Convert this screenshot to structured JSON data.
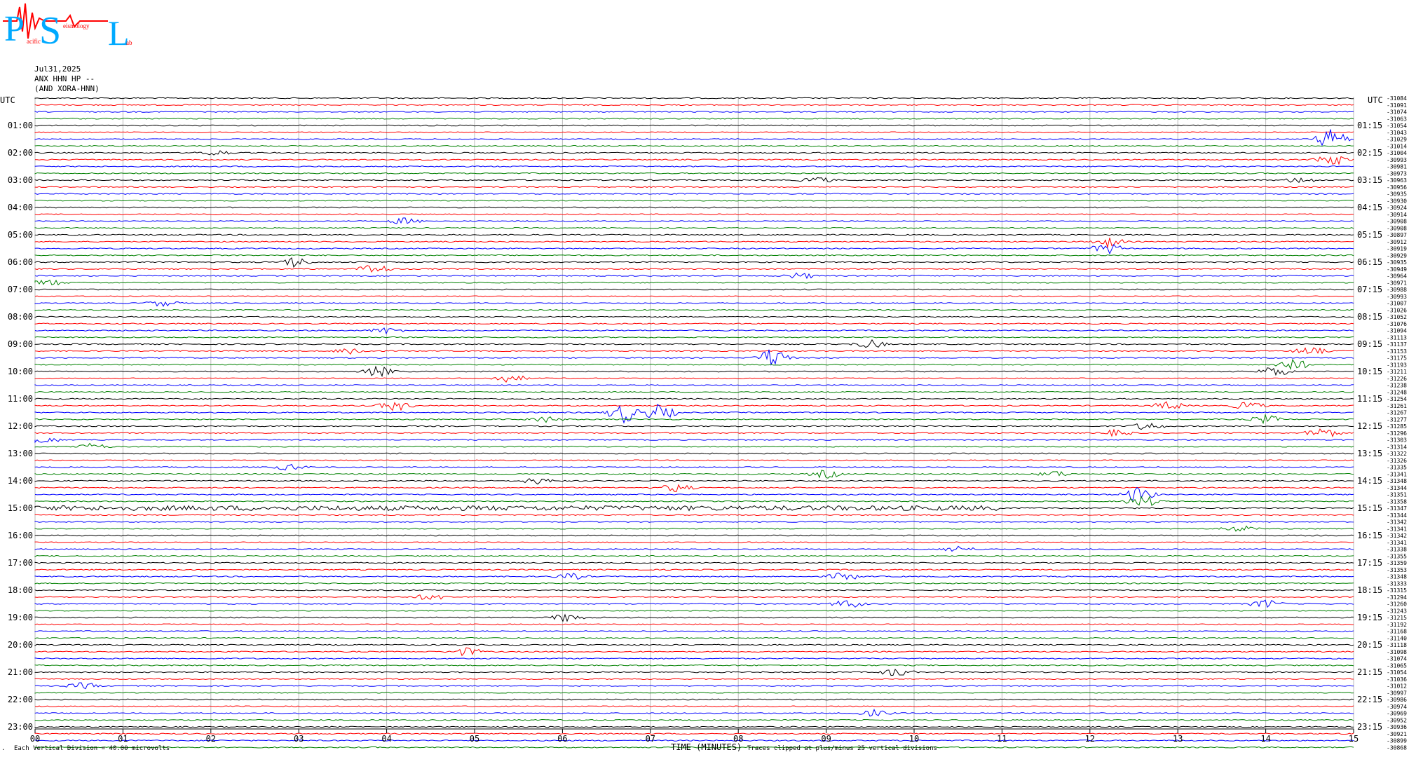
{
  "logo": {
    "letters": [
      "P",
      "S",
      "L"
    ],
    "subtext": [
      "acific",
      "eismology",
      "ab"
    ]
  },
  "header": {
    "date": "Jul31,2025",
    "channel": "ANX HHN HP --",
    "network": "(AND XORA-HNN)"
  },
  "chart_data": {
    "type": "line",
    "title": "ANX HHN HP --",
    "xlabel": "TIME (MINUTES)",
    "x_ticks": [
      "00",
      "01",
      "02",
      "03",
      "04",
      "05",
      "06",
      "07",
      "08",
      "09",
      "10",
      "11",
      "12",
      "13",
      "14",
      "15"
    ],
    "xlim": [
      0,
      15
    ],
    "left_axis_label": "UTC",
    "right_axis_label": "UTC",
    "left_hour_labels": [
      "01:00",
      "02:00",
      "03:00",
      "04:00",
      "05:00",
      "06:00",
      "07:00",
      "08:00",
      "09:00",
      "10:00",
      "11:00",
      "12:00",
      "13:00",
      "14:00",
      "15:00",
      "16:00",
      "17:00",
      "18:00",
      "19:00",
      "20:00",
      "21:00",
      "22:00",
      "23:00"
    ],
    "right_hour_labels": [
      "01:15",
      "02:15",
      "03:15",
      "04:15",
      "05:15",
      "06:15",
      "07:15",
      "08:15",
      "09:15",
      "10:15",
      "11:15",
      "12:15",
      "13:15",
      "14:15",
      "15:15",
      "16:15",
      "17:15",
      "18:15",
      "19:15",
      "20:15",
      "21:15",
      "22:15",
      "23:15"
    ],
    "trace_colors": [
      "#000000",
      "#ff0000",
      "#0000ff",
      "#008000"
    ],
    "trace_count": 96,
    "right_offsets": [
      "-31084",
      "-31091",
      "-31074",
      "-31063",
      "-31054",
      "-31043",
      "-31029",
      "-31014",
      "-31004",
      "-30993",
      "-30981",
      "-30973",
      "-30963",
      "-30956",
      "-30935",
      "-30930",
      "-30924",
      "-30914",
      "-30908",
      "-30908",
      "-30897",
      "-30912",
      "-30919",
      "-30929",
      "-30935",
      "-30949",
      "-30964",
      "-30971",
      "-30988",
      "-30993",
      "-31007",
      "-31026",
      "-31052",
      "-31076",
      "-31094",
      "-31113",
      "-31137",
      "-31153",
      "-31175",
      "-31193",
      "-31211",
      "-31226",
      "-31238",
      "-31248",
      "-31254",
      "-31261",
      "-31267",
      "-31277",
      "-31285",
      "-31296",
      "-31303",
      "-31314",
      "-31322",
      "-31326",
      "-31335",
      "-31341",
      "-31348",
      "-31344",
      "-31351",
      "-31358",
      "-31347",
      "-31344",
      "-31342",
      "-31341",
      "-31342",
      "-31341",
      "-31338",
      "-31355",
      "-31359",
      "-31353",
      "-31348",
      "-31333",
      "-31315",
      "-31294",
      "-31260",
      "-31243",
      "-31215",
      "-31192",
      "-31168",
      "-31140",
      "-31118",
      "-31098",
      "-31074",
      "-31065",
      "-31054",
      "-31036",
      "-31012",
      "-30997",
      "-30986",
      "-30974",
      "-30969",
      "-30952",
      "-30936",
      "-30921",
      "-30899",
      "-30868"
    ],
    "events": [
      {
        "trace": 6,
        "minute": 14.75,
        "amp": 5
      },
      {
        "trace": 8,
        "minute": 2.05,
        "amp": 1.5
      },
      {
        "trace": 9,
        "minute": 14.75,
        "amp": 3
      },
      {
        "trace": 12,
        "minute": 8.9,
        "amp": 1.5
      },
      {
        "trace": 12,
        "minute": 14.4,
        "amp": 1.5
      },
      {
        "trace": 18,
        "minute": 4.2,
        "amp": 1.5
      },
      {
        "trace": 21,
        "minute": 12.2,
        "amp": 2.5
      },
      {
        "trace": 22,
        "minute": 12.2,
        "amp": 2.5
      },
      {
        "trace": 24,
        "minute": 2.95,
        "amp": 2.5
      },
      {
        "trace": 25,
        "minute": 3.85,
        "amp": 2.5
      },
      {
        "trace": 26,
        "minute": 8.7,
        "amp": 1.5
      },
      {
        "trace": 27,
        "minute": 0.15,
        "amp": 1.5
      },
      {
        "trace": 30,
        "minute": 1.45,
        "amp": 1.5
      },
      {
        "trace": 34,
        "minute": 4.0,
        "amp": 1.5
      },
      {
        "trace": 36,
        "minute": 9.5,
        "amp": 2
      },
      {
        "trace": 37,
        "minute": 3.6,
        "amp": 2
      },
      {
        "trace": 37,
        "minute": 14.5,
        "amp": 2
      },
      {
        "trace": 38,
        "minute": 8.4,
        "amp": 5
      },
      {
        "trace": 39,
        "minute": 14.3,
        "amp": 3
      },
      {
        "trace": 40,
        "minute": 3.9,
        "amp": 2.5
      },
      {
        "trace": 40,
        "minute": 14.1,
        "amp": 2.5
      },
      {
        "trace": 41,
        "minute": 5.4,
        "amp": 2
      },
      {
        "trace": 45,
        "minute": 4.1,
        "amp": 2.5
      },
      {
        "trace": 45,
        "minute": 12.9,
        "amp": 2
      },
      {
        "trace": 45,
        "minute": 13.8,
        "amp": 2
      },
      {
        "trace": 46,
        "minute": 6.7,
        "amp": 5
      },
      {
        "trace": 46,
        "minute": 7.1,
        "amp": 4
      },
      {
        "trace": 47,
        "minute": 5.8,
        "amp": 1.5
      },
      {
        "trace": 47,
        "minute": 14.0,
        "amp": 2
      },
      {
        "trace": 48,
        "minute": 12.65,
        "amp": 2
      },
      {
        "trace": 49,
        "minute": 14.65,
        "amp": 3
      },
      {
        "trace": 49,
        "minute": 12.3,
        "amp": 1.5
      },
      {
        "trace": 50,
        "minute": 0.1,
        "amp": 1.5
      },
      {
        "trace": 51,
        "minute": 0.65,
        "amp": 1.5
      },
      {
        "trace": 54,
        "minute": 2.9,
        "amp": 1.5
      },
      {
        "trace": 55,
        "minute": 9.0,
        "amp": 2
      },
      {
        "trace": 55,
        "minute": 11.6,
        "amp": 1.5
      },
      {
        "trace": 56,
        "minute": 5.7,
        "amp": 1.5
      },
      {
        "trace": 57,
        "minute": 7.3,
        "amp": 2
      },
      {
        "trace": 58,
        "minute": 12.55,
        "amp": 3.5
      },
      {
        "trace": 59,
        "minute": 12.6,
        "amp": 3
      },
      {
        "trace": 63,
        "minute": 13.7,
        "amp": 1.5
      },
      {
        "trace": 66,
        "minute": 10.5,
        "amp": 1.5
      },
      {
        "trace": 70,
        "minute": 9.2,
        "amp": 2
      },
      {
        "trace": 70,
        "minute": 6.1,
        "amp": 1.5
      },
      {
        "trace": 73,
        "minute": 4.5,
        "amp": 1.5
      },
      {
        "trace": 74,
        "minute": 9.25,
        "amp": 2
      },
      {
        "trace": 74,
        "minute": 14.0,
        "amp": 2
      },
      {
        "trace": 76,
        "minute": 6.05,
        "amp": 2
      },
      {
        "trace": 81,
        "minute": 4.9,
        "amp": 2
      },
      {
        "trace": 84,
        "minute": 9.8,
        "amp": 2
      },
      {
        "trace": 86,
        "minute": 0.55,
        "amp": 1.5
      },
      {
        "trace": 90,
        "minute": 9.55,
        "amp": 1.5
      }
    ],
    "noisy_trace": 60
  },
  "footer": {
    "left": "Each Vertical Division =   40.00 microvolts",
    "xlabel": "TIME (MINUTES)",
    "note": "Traces clipped at plus/minus 25 vertical divisions",
    "corner": "."
  }
}
